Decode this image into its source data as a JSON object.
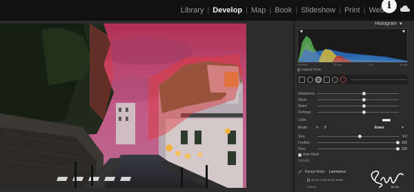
{
  "modules": [
    "Library",
    "Develop",
    "Map",
    "Book",
    "Slideshow",
    "Print",
    "Web"
  ],
  "active_module": "Develop",
  "info_badge": "i",
  "panel": {
    "title": "Histogram",
    "hist_values": [
      "ISO 800",
      "24 mm",
      "f / 11",
      "15 sec"
    ],
    "original_photo_label": "Original Photo"
  },
  "detail_sliders": [
    {
      "label": "Sharpness",
      "value": "",
      "pos": 0.55
    },
    {
      "label": "Noise",
      "value": "",
      "pos": 0.55
    },
    {
      "label": "Moiré",
      "value": "",
      "pos": 0.55
    },
    {
      "label": "Defringe",
      "value": "",
      "pos": 0.55
    }
  ],
  "color_label": "Color",
  "brush": {
    "label": "Brush :",
    "a": "A",
    "b": "B",
    "erase": "Erase",
    "sliders": [
      {
        "label": "Size",
        "value": "9.0",
        "pos": 0.5
      },
      {
        "label": "Feather",
        "value": "100",
        "pos": 0.97
      },
      {
        "label": "Flow",
        "value": "100",
        "pos": 0.97
      }
    ],
    "auto_mask_label": "Auto Mask",
    "density_label": "Density"
  },
  "range_mask": {
    "label": "Range Mask :",
    "mode": "Luminance",
    "show_label": "Show Luminance Mask",
    "range_label": "Range"
  },
  "signature_caption": "36/765"
}
